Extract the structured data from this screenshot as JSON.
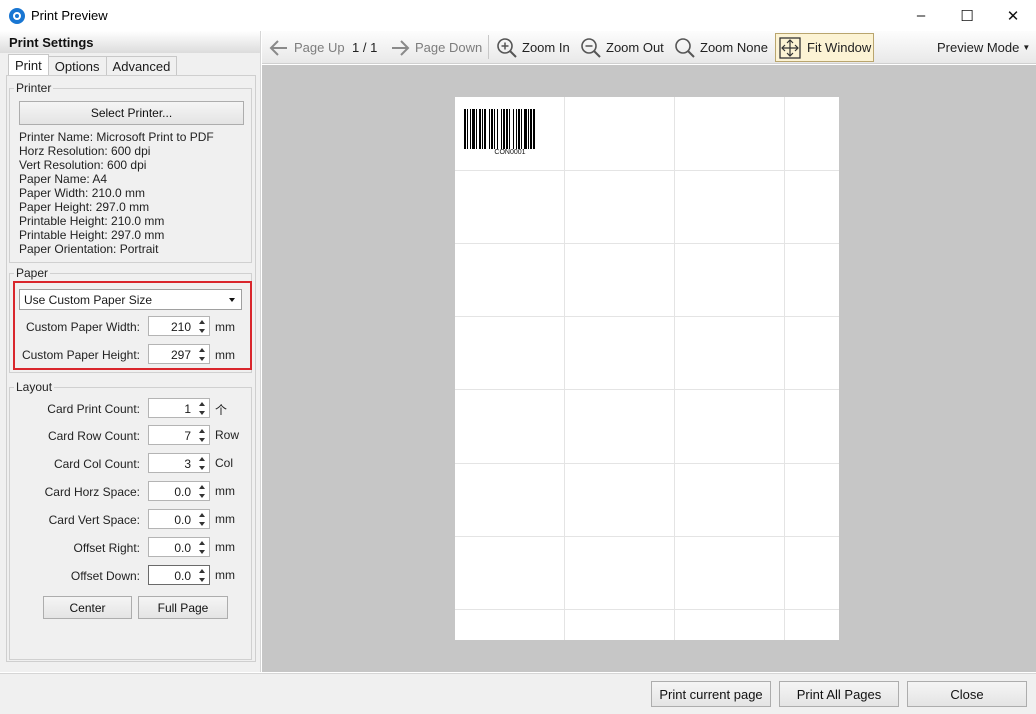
{
  "window": {
    "title": "Print Preview",
    "controls": {
      "minimize": "–",
      "maximize": "☐",
      "close": "✕"
    }
  },
  "left_panel": {
    "header": "Print Settings",
    "tabs": [
      {
        "label": "Print",
        "active": true
      },
      {
        "label": "Options",
        "active": false
      },
      {
        "label": "Advanced",
        "active": false
      }
    ],
    "printer_group": {
      "title": "Printer",
      "select_button": "Select Printer...",
      "info": [
        "Printer Name: Microsoft Print to PDF",
        "Horz Resolution: 600 dpi",
        "Vert Resolution: 600 dpi",
        "Paper Name: A4",
        "Paper Width: 210.0 mm",
        "Paper Height: 297.0 mm",
        "Printable Height: 210.0 mm",
        "Printable Height: 297.0 mm",
        "Paper Orientation: Portrait"
      ]
    },
    "paper_group": {
      "title": "Paper",
      "paper_size_select": "Use Custom Paper Size",
      "width_label": "Custom Paper Width:",
      "width_value": "210",
      "width_unit": "mm",
      "height_label": "Custom Paper Height:",
      "height_value": "297",
      "height_unit": "mm"
    },
    "layout_group": {
      "title": "Layout",
      "rows": [
        {
          "label": "Card Print Count:",
          "value": "1",
          "unit": "个"
        },
        {
          "label": "Card Row Count:",
          "value": "7",
          "unit": "Row"
        },
        {
          "label": "Card Col Count:",
          "value": "3",
          "unit": "Col"
        },
        {
          "label": "Card Horz Space:",
          "value": "0.0",
          "unit": "mm"
        },
        {
          "label": "Card Vert Space:",
          "value": "0.0",
          "unit": "mm"
        },
        {
          "label": "Offset Right:",
          "value": "0.0",
          "unit": "mm"
        },
        {
          "label": "Offset Down:",
          "value": "0.0",
          "unit": "mm"
        }
      ],
      "center_button": "Center",
      "full_page_button": "Full Page"
    }
  },
  "toolbar": {
    "page_up": "Page Up",
    "page_indicator": "1 / 1",
    "page_down": "Page Down",
    "zoom_in": "Zoom In",
    "zoom_out": "Zoom Out",
    "zoom_none": "Zoom None",
    "fit_window": "Fit Window",
    "preview_mode": "Preview Mode"
  },
  "preview": {
    "barcode_text": "CON0001",
    "grid_cols": 3,
    "grid_rows": 7
  },
  "footer": {
    "print_current": "Print current page",
    "print_all": "Print All Pages",
    "close": "Close"
  }
}
